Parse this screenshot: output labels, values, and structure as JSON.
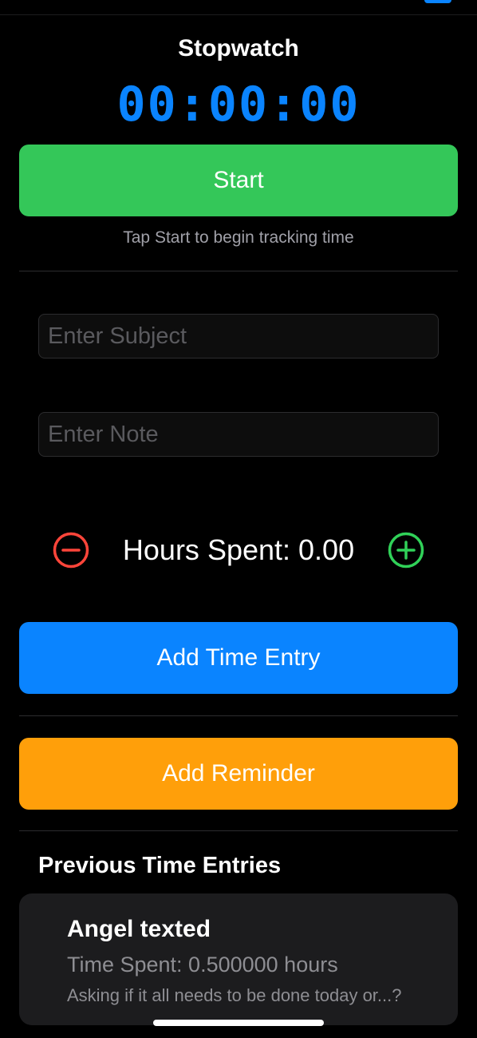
{
  "stopwatch": {
    "title": "Stopwatch",
    "time": "00:00:00",
    "start_label": "Start",
    "hint": "Tap Start to begin tracking time"
  },
  "form": {
    "subject_placeholder": "Enter Subject",
    "subject_value": "",
    "note_placeholder": "Enter Note",
    "note_value": ""
  },
  "hours": {
    "label": "Hours Spent: 0.00",
    "decrement_icon": "minus-circle-icon",
    "increment_icon": "plus-circle-icon"
  },
  "actions": {
    "add_entry_label": "Add Time Entry",
    "add_reminder_label": "Add Reminder"
  },
  "entries": {
    "title": "Previous Time Entries",
    "items": [
      {
        "subject": "Angel texted",
        "time_spent": "Time Spent: 0.500000 hours",
        "note": "Asking if it all needs to be done today or...?"
      }
    ]
  },
  "colors": {
    "background": "#000000",
    "timer": "#0a84ff",
    "start": "#34c759",
    "add_entry": "#0a84ff",
    "reminder": "#ff9f0a",
    "decrement": "#ff453a",
    "increment": "#30d158",
    "card": "#1c1c1e"
  }
}
